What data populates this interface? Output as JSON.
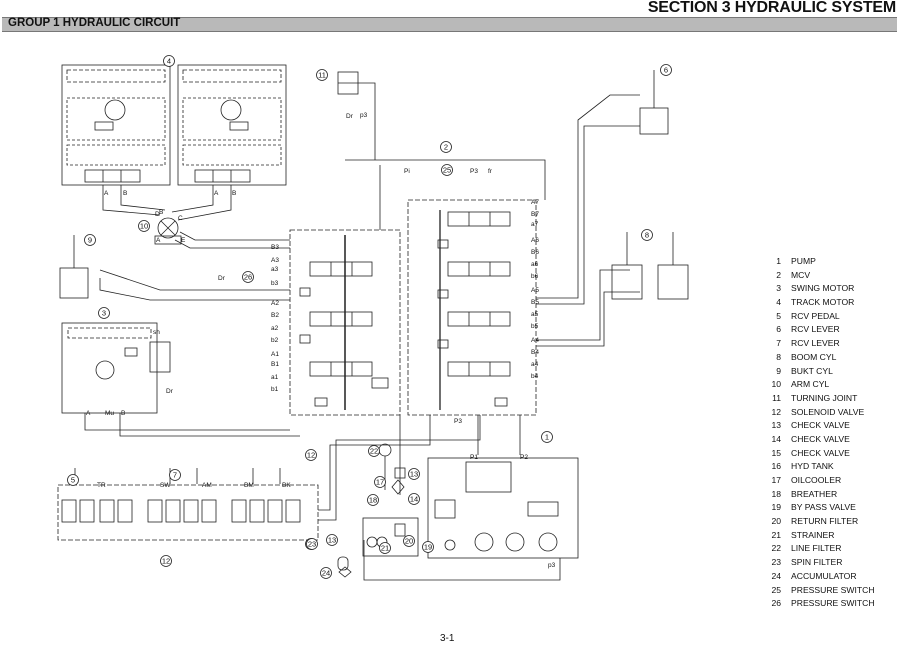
{
  "header": {
    "section_title": "SECTION 3  HYDRAULIC SYSTEM",
    "group_title": "GROUP 1  HYDRAULIC CIRCUIT"
  },
  "callouts": [
    {
      "num": "1"
    },
    {
      "num": "2"
    },
    {
      "num": "3"
    },
    {
      "num": "4"
    },
    {
      "num": "5"
    },
    {
      "num": "6"
    },
    {
      "num": "7"
    },
    {
      "num": "8"
    },
    {
      "num": "9"
    },
    {
      "num": "10"
    },
    {
      "num": "11"
    },
    {
      "num": "12"
    },
    {
      "num": "12"
    },
    {
      "num": "12"
    },
    {
      "num": "13"
    },
    {
      "num": "13"
    },
    {
      "num": "14"
    },
    {
      "num": "17"
    },
    {
      "num": "18"
    },
    {
      "num": "19"
    },
    {
      "num": "20"
    },
    {
      "num": "21"
    },
    {
      "num": "22"
    },
    {
      "num": "23"
    },
    {
      "num": "24"
    },
    {
      "num": "25"
    },
    {
      "num": "26"
    }
  ],
  "port_labels": [
    {
      "text": "A7"
    },
    {
      "text": "B7"
    },
    {
      "text": "a7"
    },
    {
      "text": "A6"
    },
    {
      "text": "B6"
    },
    {
      "text": "a6"
    },
    {
      "text": "b6"
    },
    {
      "text": "A5"
    },
    {
      "text": "B5"
    },
    {
      "text": "a5"
    },
    {
      "text": "b5"
    },
    {
      "text": "A4"
    },
    {
      "text": "B4"
    },
    {
      "text": "a4"
    },
    {
      "text": "b4"
    },
    {
      "text": "B3"
    },
    {
      "text": "A3"
    },
    {
      "text": "a3"
    },
    {
      "text": "b3"
    },
    {
      "text": "A2"
    },
    {
      "text": "B2"
    },
    {
      "text": "a2"
    },
    {
      "text": "b2"
    },
    {
      "text": "A1"
    },
    {
      "text": "B1"
    },
    {
      "text": "a1"
    },
    {
      "text": "b1"
    },
    {
      "text": "P3"
    },
    {
      "text": "P3"
    },
    {
      "text": "Pi"
    },
    {
      "text": "fr"
    },
    {
      "text": "Dr"
    },
    {
      "text": "Dr"
    },
    {
      "text": "Dr"
    },
    {
      "text": "p3"
    },
    {
      "text": "p3"
    },
    {
      "text": "TR"
    },
    {
      "text": "SW"
    },
    {
      "text": "AM"
    },
    {
      "text": "BM"
    },
    {
      "text": "BK"
    },
    {
      "text": "Mu"
    },
    {
      "text": "P1"
    },
    {
      "text": "P2"
    },
    {
      "text": "sh"
    },
    {
      "text": "A"
    },
    {
      "text": "B"
    },
    {
      "text": "C"
    },
    {
      "text": "D"
    },
    {
      "text": "E"
    },
    {
      "text": "A"
    },
    {
      "text": "B"
    },
    {
      "text": "A"
    },
    {
      "text": "B"
    },
    {
      "text": "A"
    },
    {
      "text": "B"
    }
  ],
  "legend": [
    {
      "num": "1",
      "name": "PUMP"
    },
    {
      "num": "2",
      "name": "MCV"
    },
    {
      "num": "3",
      "name": "SWING MOTOR"
    },
    {
      "num": "4",
      "name": "TRACK MOTOR"
    },
    {
      "num": "5",
      "name": "RCV PEDAL"
    },
    {
      "num": "6",
      "name": "RCV LEVER"
    },
    {
      "num": "7",
      "name": "RCV LEVER"
    },
    {
      "num": "8",
      "name": "BOOM CYL"
    },
    {
      "num": "9",
      "name": "BUKT CYL"
    },
    {
      "num": "10",
      "name": "ARM CYL"
    },
    {
      "num": "11",
      "name": "TURNING JOINT"
    },
    {
      "num": "12",
      "name": "SOLENOID VALVE"
    },
    {
      "num": "13",
      "name": "CHECK VALVE"
    },
    {
      "num": "14",
      "name": "CHECK VALVE"
    },
    {
      "num": "15",
      "name": "CHECK VALVE"
    },
    {
      "num": "16",
      "name": "HYD TANK"
    },
    {
      "num": "17",
      "name": "OILCOOLER"
    },
    {
      "num": "18",
      "name": "BREATHER"
    },
    {
      "num": "19",
      "name": "BY PASS VALVE"
    },
    {
      "num": "20",
      "name": "RETURN FILTER"
    },
    {
      "num": "21",
      "name": "STRAINER"
    },
    {
      "num": "22",
      "name": "LINE FILTER"
    },
    {
      "num": "23",
      "name": "SPIN FILTER"
    },
    {
      "num": "24",
      "name": "ACCUMULATOR"
    },
    {
      "num": "25",
      "name": "PRESSURE SWITCH"
    },
    {
      "num": "26",
      "name": "PRESSURE SWITCH"
    }
  ],
  "page_number": "3-1"
}
